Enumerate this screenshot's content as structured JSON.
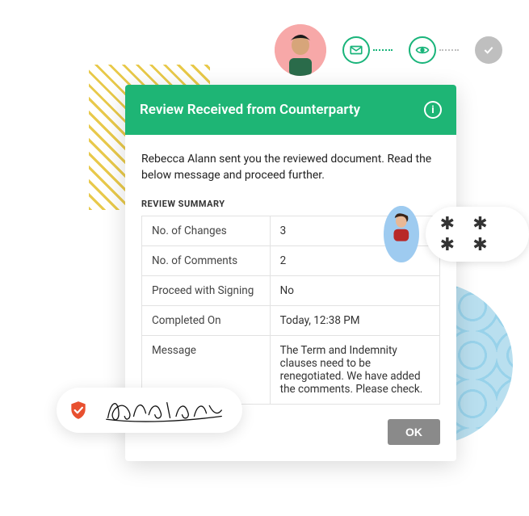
{
  "colors": {
    "accent": "#1eb575",
    "shield": "#e8502f",
    "okButton": "#8a8a8a"
  },
  "timeline": {
    "steps": [
      "mail",
      "eye",
      "check"
    ]
  },
  "card": {
    "title": "Review Received from Counterparty",
    "intro": "Rebecca Alann sent you the reviewed document. Read the below message and proceed further.",
    "summaryLabel": "REVIEW SUMMARY",
    "rows": [
      {
        "label": "No. of Changes",
        "value": "3"
      },
      {
        "label": "No. of Comments",
        "value": "2"
      },
      {
        "label": "Proceed with Signing",
        "value": "No"
      },
      {
        "label": "Completed On",
        "value": "Today, 12:38 PM"
      },
      {
        "label": "Message",
        "value": "The Term and Indemnity clauses need to be renegotiated. We have added the comments. Please check."
      }
    ],
    "okLabel": "OK"
  },
  "pin": {
    "masked": "✱ ✱ ✱ ✱"
  }
}
